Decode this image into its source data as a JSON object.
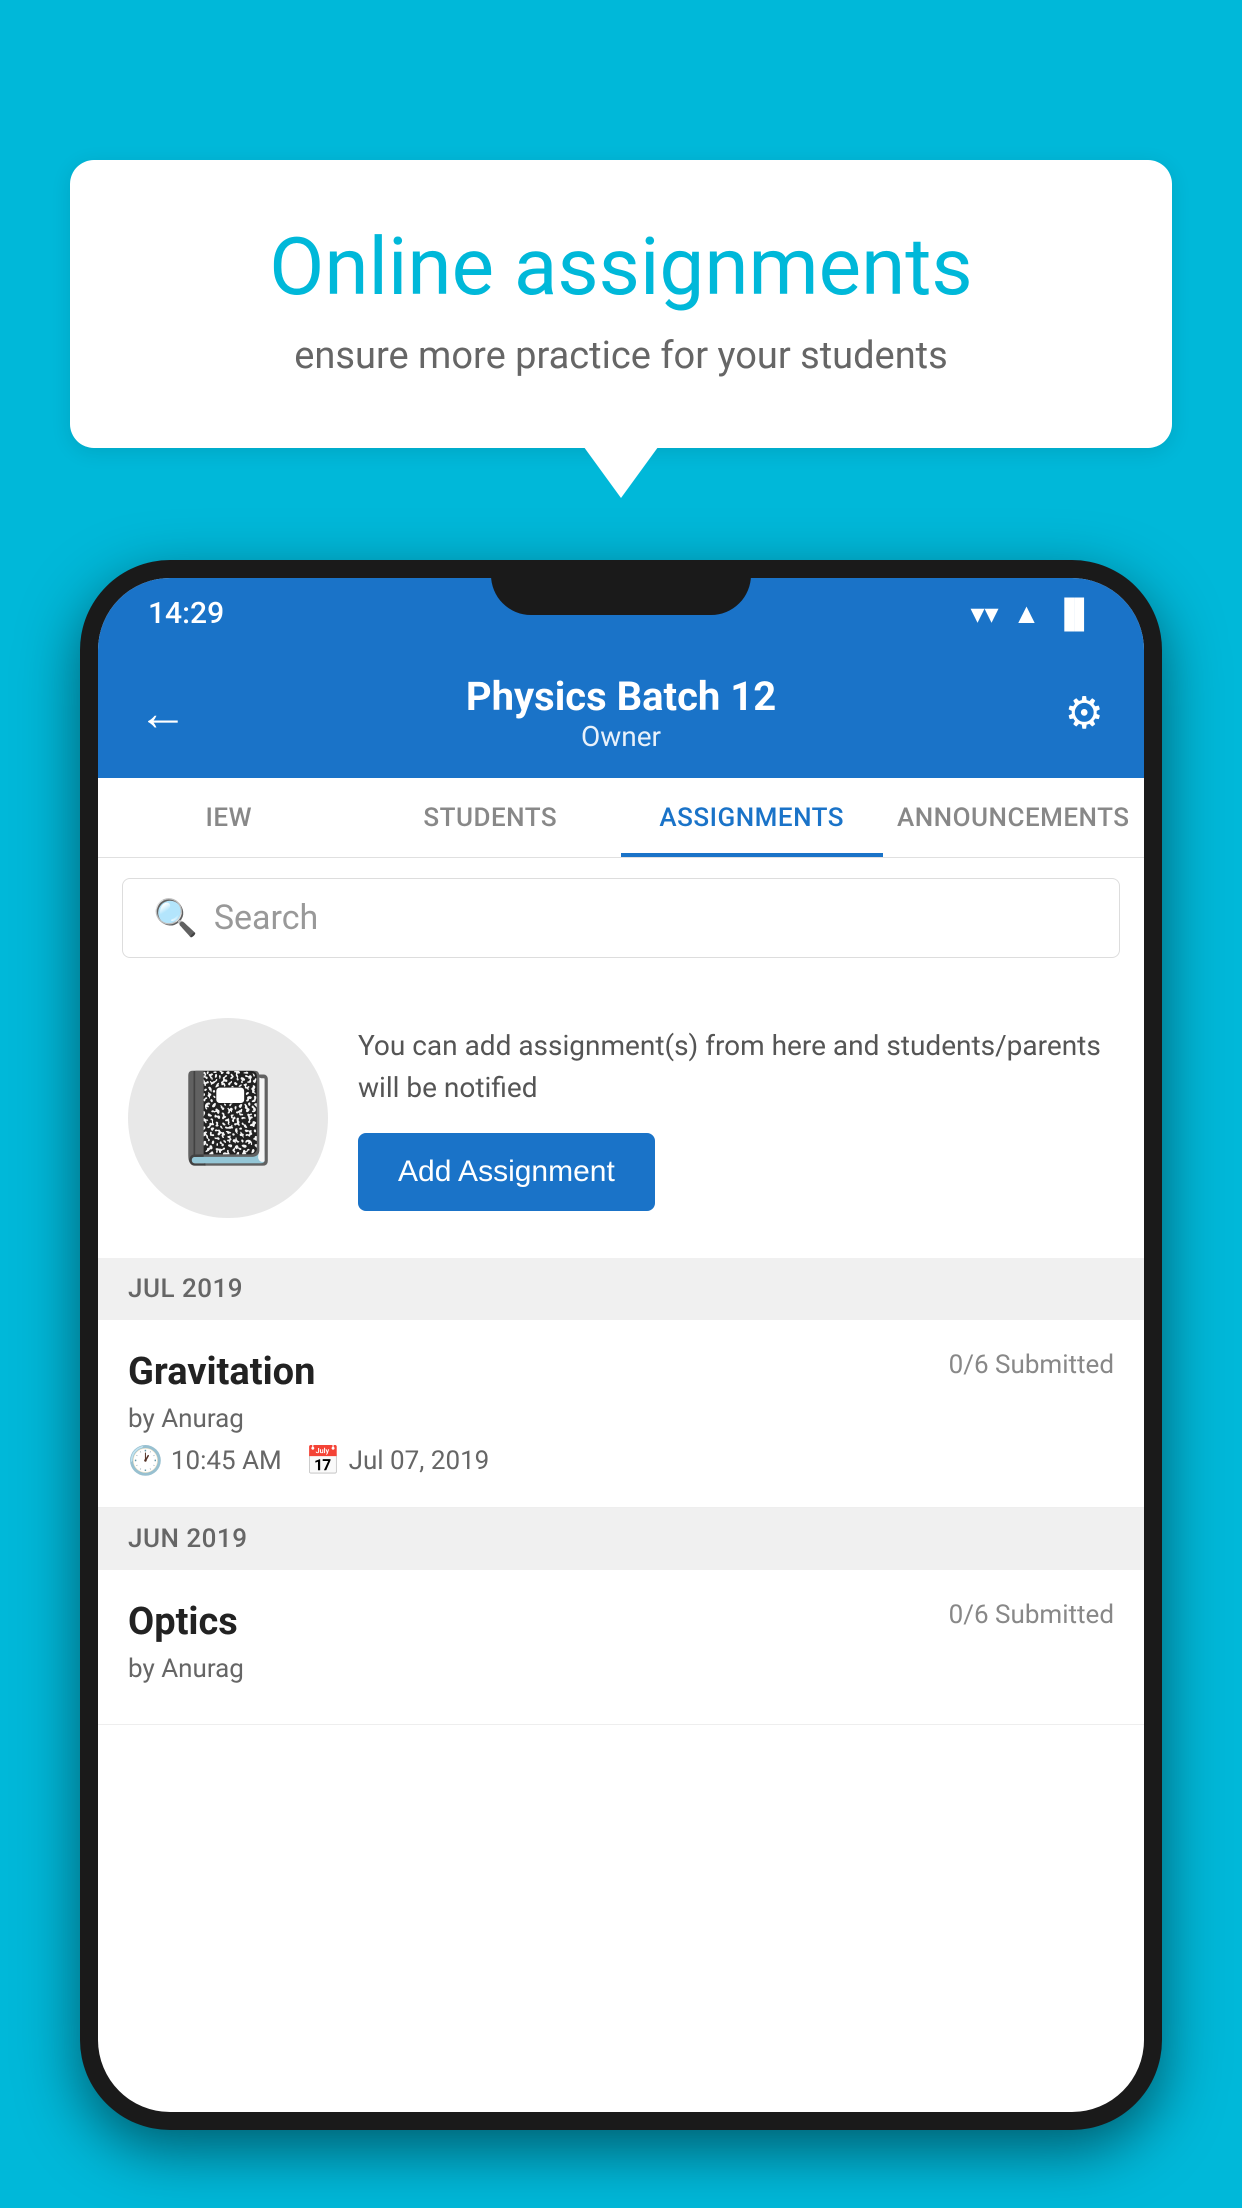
{
  "background": {
    "color": "#00B8D9"
  },
  "speech_bubble": {
    "title": "Online assignments",
    "subtitle": "ensure more practice for your students"
  },
  "status_bar": {
    "time": "14:29",
    "wifi": "▼",
    "signal": "▲",
    "battery": "▐"
  },
  "app_bar": {
    "title": "Physics Batch 12",
    "subtitle": "Owner",
    "back_label": "←",
    "settings_label": "⚙"
  },
  "tabs": [
    {
      "label": "IEW",
      "active": false
    },
    {
      "label": "STUDENTS",
      "active": false
    },
    {
      "label": "ASSIGNMENTS",
      "active": true
    },
    {
      "label": "ANNOUNCEMENTS",
      "active": false
    }
  ],
  "search": {
    "placeholder": "Search"
  },
  "promo": {
    "description": "You can add assignment(s) from here and students/parents will be notified",
    "add_button_label": "Add Assignment"
  },
  "assignments": {
    "sections": [
      {
        "month": "JUL 2019",
        "items": [
          {
            "title": "Gravitation",
            "submitted": "0/6 Submitted",
            "by": "by Anurag",
            "time": "10:45 AM",
            "date": "Jul 07, 2019"
          }
        ]
      },
      {
        "month": "JUN 2019",
        "items": [
          {
            "title": "Optics",
            "submitted": "0/6 Submitted",
            "by": "by Anurag",
            "time": "",
            "date": ""
          }
        ]
      }
    ]
  }
}
